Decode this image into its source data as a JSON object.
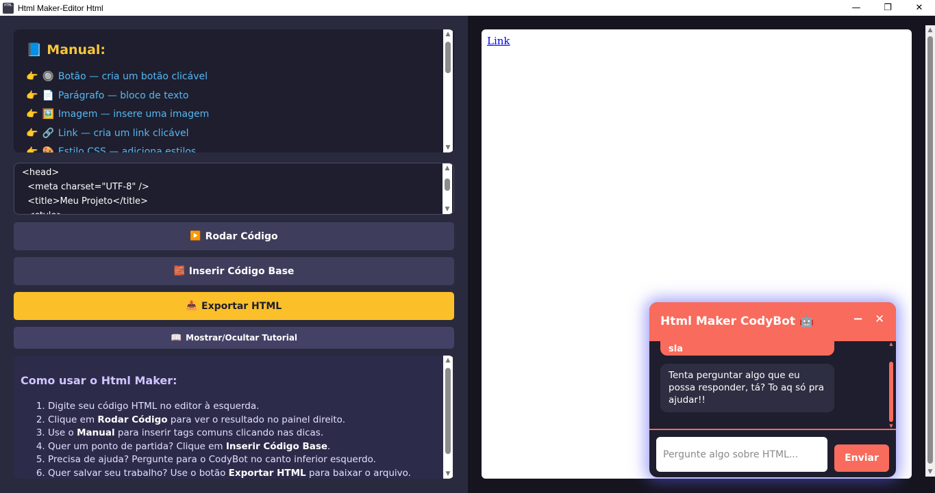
{
  "window": {
    "title": "Html Maker-Editor Html",
    "icon_text": "HTML",
    "minimize_glyph": "—",
    "maximize_glyph": "❐",
    "close_glyph": "✕"
  },
  "manual": {
    "icon": "📘",
    "title": "Manual:",
    "pointer": "👉",
    "items": [
      {
        "icon": "🔘",
        "label": "Botão — cria um botão clicável"
      },
      {
        "icon": "📄",
        "label": "Parágrafo — bloco de texto"
      },
      {
        "icon": "🖼️",
        "label": "Imagem — insere uma imagem"
      },
      {
        "icon": "🔗",
        "label": "Link — cria um link clicável"
      },
      {
        "icon": "🎨",
        "label": "Estilo CSS — adiciona estilos"
      }
    ]
  },
  "editor": {
    "code": "<head>\n  <meta charset=\"UTF-8\" />\n  <title>Meu Projeto</title>\n  <style>"
  },
  "buttons": {
    "run": {
      "icon": "▶️",
      "label": "Rodar Código"
    },
    "base": {
      "icon": "🧱",
      "label": "Inserir Código Base"
    },
    "export": {
      "icon": "📥",
      "label": "Exportar HTML"
    },
    "tutorial": {
      "icon": "📖",
      "label": "Mostrar/Ocultar Tutorial"
    }
  },
  "tutorial": {
    "title": "Como usar o Html Maker:",
    "steps": [
      {
        "pre": "Digite seu código HTML no editor à esquerda.",
        "bold": "",
        "post": ""
      },
      {
        "pre": "Clique em ",
        "bold": "Rodar Código",
        "post": " para ver o resultado no painel direito."
      },
      {
        "pre": "Use o ",
        "bold": "Manual",
        "post": " para inserir tags comuns clicando nas dicas."
      },
      {
        "pre": "Quer um ponto de partida? Clique em ",
        "bold": "Inserir Código Base",
        "post": "."
      },
      {
        "pre": "Precisa de ajuda? Pergunte para o CodyBot no canto inferior esquerdo.",
        "bold": "",
        "post": ""
      },
      {
        "pre": "Quer salvar seu trabalho? Use o botão ",
        "bold": "Exportar HTML",
        "post": " para baixar o arquivo."
      }
    ]
  },
  "preview": {
    "link_text": "Link"
  },
  "chatbot": {
    "title": "Html Maker CodyBot",
    "title_icon": "🤖",
    "minimize_glyph": "−",
    "close_glyph": "✕",
    "user_message": "sla",
    "bot_message": "Tenta perguntar algo que eu possa responder, tá? To aq só pra ajudar!!",
    "input_placeholder": "Pergunte algo sobre HTML...",
    "send_label": "Enviar"
  }
}
